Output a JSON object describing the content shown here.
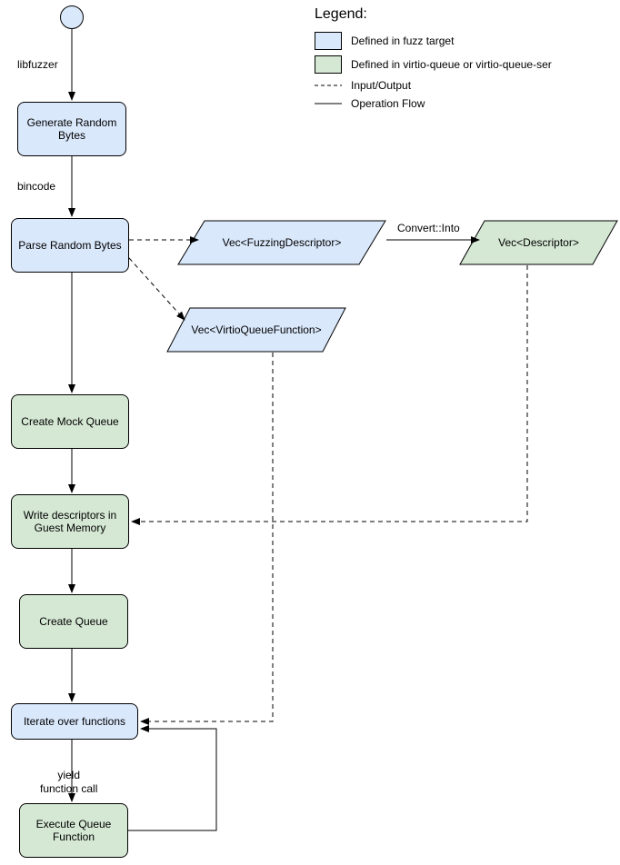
{
  "legend": {
    "title": "Legend:",
    "fuzz_target": "Defined in fuzz target",
    "virtio_queue": "Defined in virtio-queue or virtio-queue-ser",
    "input_output": "Input/Output",
    "operation_flow": "Operation Flow"
  },
  "labels": {
    "libfuzzer": "libfuzzer",
    "bincode": "bincode",
    "convert_into": "Convert::Into",
    "yield_call": "yield\nfunction call"
  },
  "nodes": {
    "generate_random_bytes": "Generate Random\nBytes",
    "parse_random_bytes": "Parse Random Bytes",
    "vec_fuzzing_descriptor": "Vec<FuzzingDescriptor>",
    "vec_descriptor": "Vec<Descriptor>",
    "vec_virtio_queue_function": "Vec<VirtioQueueFunction>",
    "create_mock_queue": "Create Mock Queue",
    "write_descriptors": "Write descriptors in\nGuest Memory",
    "create_queue": "Create Queue",
    "iterate_over_functions": "Iterate over functions",
    "execute_queue_function": "Execute Queue\nFunction"
  },
  "colors": {
    "blue": "#DAE8FC",
    "green": "#D5E8D4"
  }
}
